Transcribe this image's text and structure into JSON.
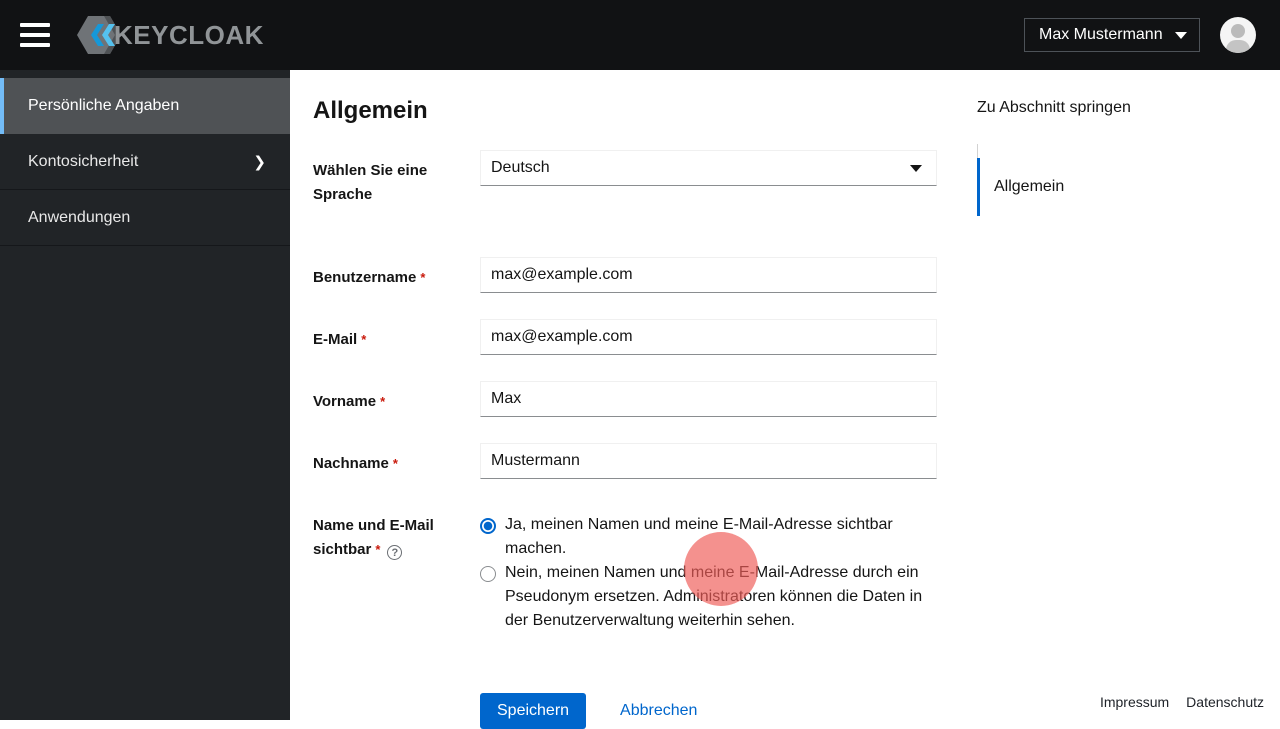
{
  "topbar": {
    "brand": "KEYCLOAK",
    "user_name": "Max Mustermann"
  },
  "sidebar": {
    "items": [
      {
        "label": "Persönliche Angaben",
        "active": true
      },
      {
        "label": "Kontosicherheit",
        "expandable": true,
        "chevron": "❯"
      },
      {
        "label": "Anwendungen"
      }
    ]
  },
  "main": {
    "title": "Allgemein",
    "form": {
      "required_marker": "*",
      "language": {
        "label": "Wählen Sie eine Sprache",
        "value": "Deutsch"
      },
      "fields": [
        {
          "label": "Benutzername",
          "required": true,
          "value": "max@example.com"
        },
        {
          "label": "E-Mail",
          "required": true,
          "value": "max@example.com"
        },
        {
          "label": "Vorname",
          "required": true,
          "value": "Max"
        },
        {
          "label": "Nachname",
          "required": true,
          "value": "Mustermann"
        }
      ],
      "visibility": {
        "label": "Name und E-Mail sichtbar",
        "help_icon": "?",
        "options": [
          {
            "text": "Ja, meinen Namen und meine E-Mail-Adresse sichtbar machen.",
            "selected": true
          },
          {
            "text": "Nein, meinen Namen und meine E-Mail-Adresse durch ein Pseudonym ersetzen. Administratoren können die Daten in der Benutzerverwaltung weiterhin sehen.",
            "selected": false
          }
        ]
      },
      "save_label": "Speichern",
      "cancel_label": "Abbrechen"
    }
  },
  "jump_panel": {
    "title": "Zu Abschnitt springen",
    "items": [
      {
        "label": "Allgemein",
        "active": true
      }
    ]
  },
  "footer": {
    "links": [
      "Impressum",
      "Datenschutz"
    ]
  },
  "colors": {
    "accent_blue": "#0066cc",
    "sidebar_active_border": "#73bcf7",
    "topbar_bg": "#111214",
    "sidebar_bg": "#212427",
    "required_red": "#c9190b",
    "click_indicator": "rgba(239,93,88,0.68)"
  }
}
